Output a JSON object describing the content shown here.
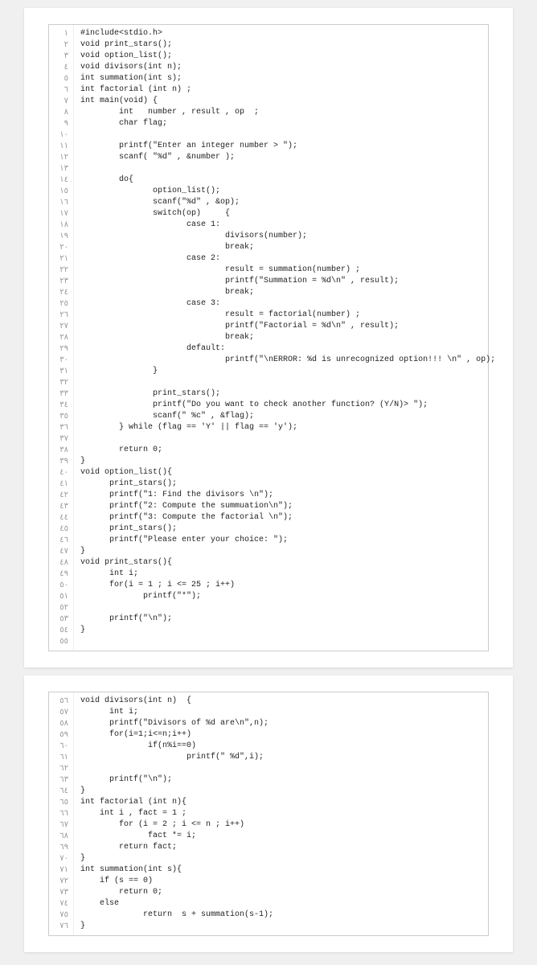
{
  "block1": {
    "line_start": 1,
    "line_end": 55,
    "gutter_glyphs": [
      "١",
      "٢",
      "٣",
      "٤",
      "٥",
      "٦",
      "٧",
      "٨",
      "٩",
      "١٠",
      "١١",
      "١٢",
      "١٣",
      "١٤",
      "١٥",
      "١٦",
      "١٧",
      "١٨",
      "١٩",
      "٢٠",
      "٢١",
      "٢٢",
      "٢٣",
      "٢٤",
      "٢٥",
      "٢٦",
      "٢٧",
      "٢٨",
      "٢٩",
      "٣٠",
      "٣١",
      "٣٢",
      "٣٣",
      "٣٤",
      "٣٥",
      "٣٦",
      "٣٧",
      "٣٨",
      "٣٩",
      "٤٠",
      "٤١",
      "٤٢",
      "٤٣",
      "٤٤",
      "٤٥",
      "٤٦",
      "٤٧",
      "٤٨",
      "٤٩",
      "٥٠",
      "٥١",
      "٥٢",
      "٥٣",
      "٥٤",
      "٥٥"
    ],
    "lines": [
      "#include<stdio.h>",
      "void print_stars();",
      "void option_list();",
      "void divisors(int n);",
      "int summation(int s);",
      "int factorial (int n) ;",
      "int main(void) {",
      "        int   number , result , op  ;",
      "        char flag;",
      "",
      "        printf(\"Enter an integer number > \");",
      "        scanf( \"%d\" , &number );",
      "",
      "        do{",
      "               option_list();",
      "               scanf(\"%d\" , &op);",
      "               switch(op)     {",
      "                      case 1:",
      "                              divisors(number);",
      "                              break;",
      "                      case 2:",
      "                              result = summation(number) ;",
      "                              printf(\"Summation = %d\\n\" , result);",
      "                              break;",
      "                      case 3:",
      "                              result = factorial(number) ;",
      "                              printf(\"Factorial = %d\\n\" , result);",
      "                              break;",
      "                      default:",
      "                              printf(\"\\nERROR: %d is unrecognized option!!! \\n\" , op);",
      "               }",
      "",
      "               print_stars();",
      "               printf(\"Do you want to check another function? (Y/N)> \");",
      "               scanf(\" %c\" , &flag);",
      "        } while (flag == 'Y' || flag == 'y');",
      "",
      "        return 0;",
      "}",
      "void option_list(){",
      "      print_stars();",
      "      printf(\"1: Find the divisors \\n\");",
      "      printf(\"2: Compute the summuation\\n\");",
      "      printf(\"3: Compute the factorial \\n\");",
      "      print_stars();",
      "      printf(\"Please enter your choice: \");",
      "}",
      "void print_stars(){",
      "      int i;",
      "      for(i = 1 ; i <= 25 ; i++)",
      "             printf(\"*\");",
      "",
      "      printf(\"\\n\");",
      "}",
      ""
    ]
  },
  "block2": {
    "line_start": 56,
    "line_end": 76,
    "gutter_glyphs": [
      "٥٦",
      "٥٧",
      "٥٨",
      "٥٩",
      "٦٠",
      "٦١",
      "٦٢",
      "٦٣",
      "٦٤",
      "٦٥",
      "٦٦",
      "٦٧",
      "٦٨",
      "٦٩",
      "٧٠",
      "٧١",
      "٧٢",
      "٧٣",
      "٧٤",
      "٧٥",
      "٧٦"
    ],
    "lines": [
      "void divisors(int n)  {",
      "      int i;",
      "      printf(\"Divisors of %d are\\n\",n);",
      "      for(i=1;i<=n;i++)",
      "              if(n%i==0)",
      "                      printf(\" %d\",i);",
      "",
      "      printf(\"\\n\");",
      "}",
      "int factorial (int n){",
      "    int i , fact = 1 ;",
      "        for (i = 2 ; i <= n ; i++)",
      "              fact *= i;",
      "        return fact;",
      "}",
      "int summation(int s){",
      "    if (s == 0)",
      "        return 0;",
      "    else",
      "             return  s + summation(s-1);",
      "}"
    ]
  }
}
